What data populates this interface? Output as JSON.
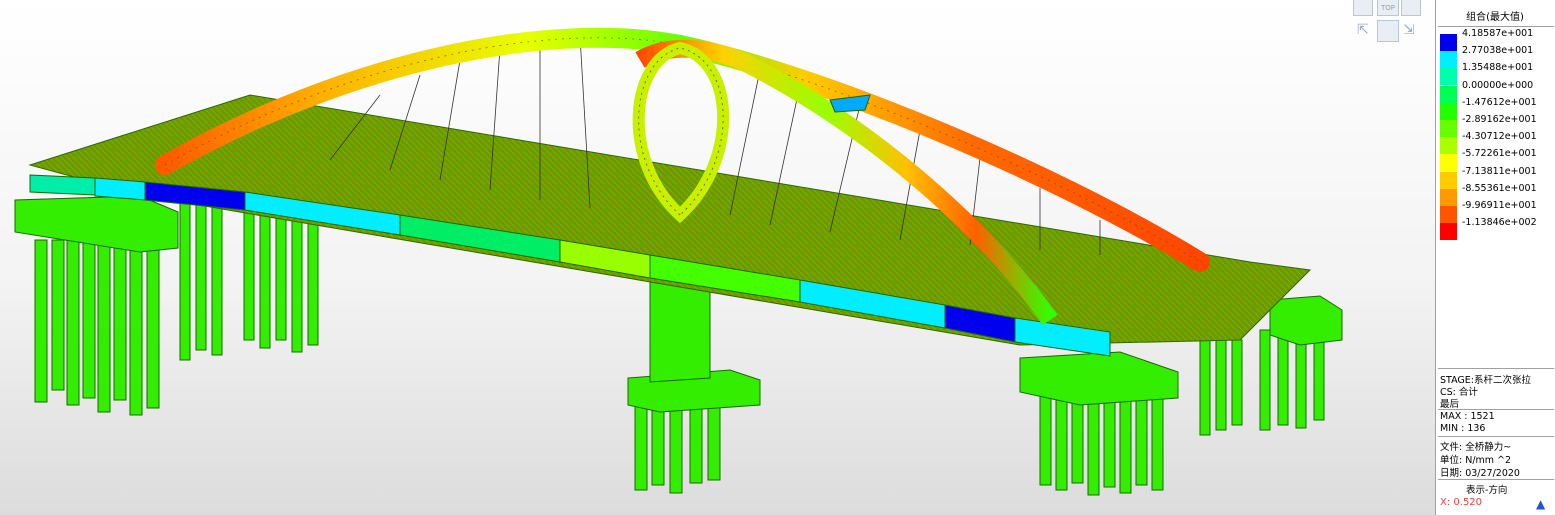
{
  "legend": {
    "title": "组合(最大值)",
    "entries": [
      {
        "value": "4.18587e+001",
        "color": "#0000ee"
      },
      {
        "value": "2.77038e+001",
        "color": "#00eeff"
      },
      {
        "value": "1.35488e+001",
        "color": "#00ffaa"
      },
      {
        "value": "0.00000e+000",
        "color": "#00ff55"
      },
      {
        "value": "-1.47612e+001",
        "color": "#22ff00"
      },
      {
        "value": "-2.89162e+001",
        "color": "#66ff00"
      },
      {
        "value": "-4.30712e+001",
        "color": "#aaff00"
      },
      {
        "value": "-5.72261e+001",
        "color": "#ffff00"
      },
      {
        "value": "-7.13811e+001",
        "color": "#ffcc00"
      },
      {
        "value": "-8.55361e+001",
        "color": "#ff9900"
      },
      {
        "value": "-9.96911e+001",
        "color": "#ff5500"
      },
      {
        "value": "-1.13846e+002",
        "color": "#ff0000"
      }
    ]
  },
  "info": {
    "stage": "STAGE:系杆二次张拉",
    "cs": "CS: 合计",
    "last": "最后",
    "max": "MAX : 1521",
    "min": "MIN : 136",
    "file": "文件: 全桥静力~",
    "unit": "单位: N/mm ^2",
    "date": "日期: 03/27/2020",
    "direction": "表示-方向",
    "coord": "X: 0.520"
  },
  "view_cube": {
    "top_label": "TOP"
  }
}
